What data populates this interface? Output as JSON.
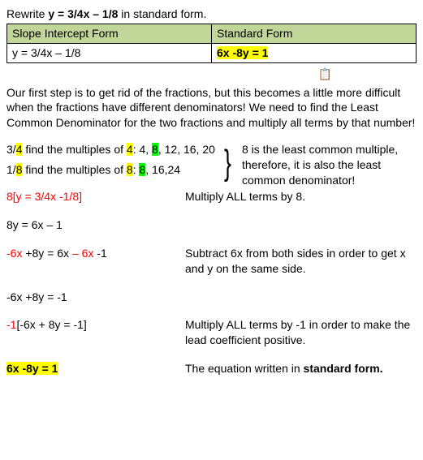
{
  "title_pre": "Rewrite ",
  "title_eq": "y = 3/4x – 1/8",
  "title_post": " in standard form.",
  "table": {
    "h1": "Slope Intercept Form",
    "h2": "Standard Form",
    "c1": "y = 3/4x – 1/8",
    "c2": "6x -8y = 1"
  },
  "paste_icon": "📋",
  "intro": "Our first step is to get rid of the fractions, but this becomes a little more difficult when the fractions have different denominators!  We need to find the Least Common Denominator for the two fractions and multiply all terms by that number!",
  "fr": {
    "l1a": "3/",
    "l1four": "4",
    "l1b": "   find the multiples of ",
    "l1four2": "4",
    "l1c": ":  4, ",
    "l1eight": "8",
    "l1d": ", 12, 16, 20",
    "l2a": "1/",
    "l2eight": "8",
    "l2b": "   find the multiples of ",
    "l2eight2": "8",
    "l2c": ":  ",
    "l2eight3": "8",
    "l2d": ", 16,24",
    "note": "8 is the least common multiple, therefore, it is also the least common denominator!"
  },
  "steps": {
    "s1l": "8[y = 3/4x -1/8]",
    "s1r": "Multiply ALL terms by 8.",
    "s2l": "8y = 6x – 1",
    "s3la": "-6x",
    "s3lb": " +8y = 6x ",
    "s3lc": "– 6x ",
    "s3ld": "-1",
    "s3r": "Subtract 6x from both sides in order to get x and y on the same side.",
    "s4l": "-6x +8y = -1",
    "s5la": "-1",
    "s5lb": "[-6x + 8y = -1]",
    "s5r": "Multiply ALL terms by -1 in order to make the lead coefficient positive.",
    "s6l": "6x -8y = 1",
    "s6ra": "The equation written in ",
    "s6rb": "standard form."
  }
}
